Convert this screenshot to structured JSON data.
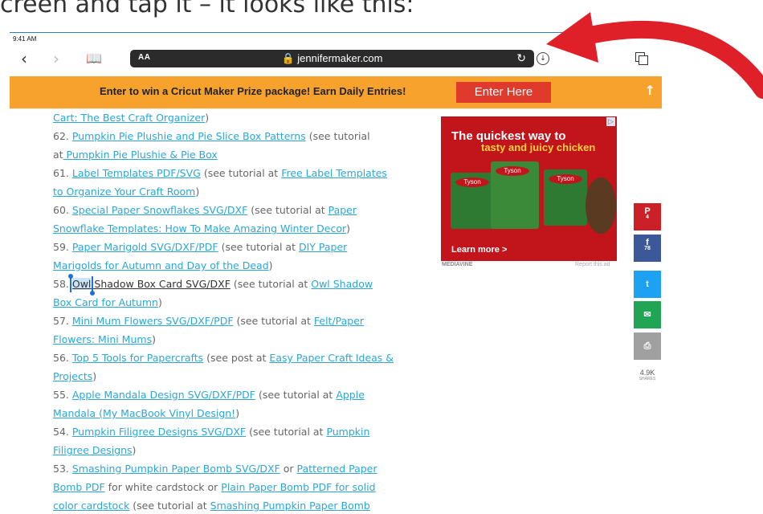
{
  "caption": "creen and tap it – it looks like this:",
  "status_bar": {
    "time": "9:41 AM"
  },
  "toolbar": {
    "back_icon": "chevron-left",
    "forward_icon": "chevron-right",
    "bookmarks_icon": "book",
    "text_size_label": "AA",
    "url": "🔒 jennifermaker.com",
    "reload_icon": "↻",
    "download_icon": "download-circle",
    "tabs_icon": "tabs"
  },
  "promo": {
    "text": "Enter to win a Cricut Maker Prize package! Earn Daily Entries!",
    "button": "Enter Here",
    "up_arrow": "↑"
  },
  "list": {
    "l0": {
      "link": "Cart: The Best Craft Organizer",
      "after": ")"
    },
    "l1": {
      "num": "62.",
      "link": "Pumpkin Pie Plushie and Pie Slice Box Patterns",
      "after": " (see tutorial"
    },
    "l2": {
      "before": "at",
      "link": " Pumpkin Pie Plushie & Pie Box"
    },
    "l3": {
      "num": "61.",
      "link": "Label Templates PDF/SVG",
      "mid": " (see tutorial at ",
      "link2": "Free Label Templates"
    },
    "l4": {
      "link": "to Organize Your Craft Room",
      "after": ")"
    },
    "l5": {
      "num": "60.",
      "link": "Special Paper Snowflakes SVG/DXF",
      "mid": " (see tutorial at ",
      "link2": "Paper"
    },
    "l6": {
      "link": "Snowflake Templates: How To Make Amazing Winter Decor",
      "after": ")"
    },
    "l7": {
      "num": "59.",
      "link": "Paper Marigold SVG/DXF/PDF",
      "mid": " (see tutorial at ",
      "link2": "DIY Paper"
    },
    "l8": {
      "link": "Marigolds for Autumn and Day of the Dead",
      "after": ")"
    },
    "l9": {
      "num": "58.",
      "selected": "Owl",
      "rest": " Shadow Box Card SVG/DXF",
      "mid": " (see tutorial at ",
      "link2": "Owl Shadow"
    },
    "l10": {
      "link": "Box Card for Autumn",
      "after": ")"
    },
    "l11": {
      "num": "57.",
      "link": "Mini Mum Flowers SVG/DXF/PDF",
      "mid": " (see tutorial at ",
      "link2": "Felt/Paper"
    },
    "l12": {
      "link": "Flowers: Mini Mums",
      "after": ")"
    },
    "l13": {
      "num": "56.",
      "link": "Top 5 Tools for Papercrafts",
      "mid": " (see post at ",
      "link2": "Easy Paper Craft Ideas &"
    },
    "l14": {
      "link": "Projects",
      "after": ")"
    },
    "l15": {
      "num": "55.",
      "link": "Apple Mandala Design SVG/DXF/PDF",
      "mid": " (see tutorial at ",
      "link2": "Apple"
    },
    "l16": {
      "link": "Mandala (My MacBook Vinyl Design!",
      "after": ")"
    },
    "l17": {
      "num": "54.",
      "link": "Pumpkin Filigree Designs SVG/DXF",
      "mid": " (see tutorial at ",
      "link2": "Pumpkin"
    },
    "l18": {
      "link": "Filigree Designs",
      "after": ")"
    },
    "l19": {
      "num": "53.",
      "link": "Smashing Pumpkin Paper Bomb SVG/DXF",
      "mid": " or ",
      "link2": "Patterned Paper"
    },
    "l20": {
      "link": "Bomb PDF",
      "mid": " for white cardstock or ",
      "link2": "Plain Paper Bomb PDF for solid"
    },
    "l21": {
      "link": "color cardstock",
      "mid": " (see tutorial at ",
      "link2": "Smashing Pumpkin Paper Bomb"
    }
  },
  "ad": {
    "headline1": "The quickest way to",
    "headline2": "tasty and juicy chicken",
    "brand": "Tyson",
    "cta": "Learn more >",
    "adchoices": "▷",
    "network": "MEDIAVINE",
    "report": "Report this ad"
  },
  "share": {
    "pinterest": {
      "glyph": "P",
      "count": "4",
      "color": "#cb2027"
    },
    "facebook": {
      "glyph": "f",
      "count": "78",
      "color": "#3b5998"
    },
    "twitter": {
      "glyph": "t",
      "color": "#1da1f2"
    },
    "email": {
      "glyph": "✉",
      "color": "#21a453"
    },
    "print": {
      "glyph": "⎙",
      "color": "#a0a0a0"
    },
    "total": "4.9K",
    "total_label": "SHARES"
  }
}
